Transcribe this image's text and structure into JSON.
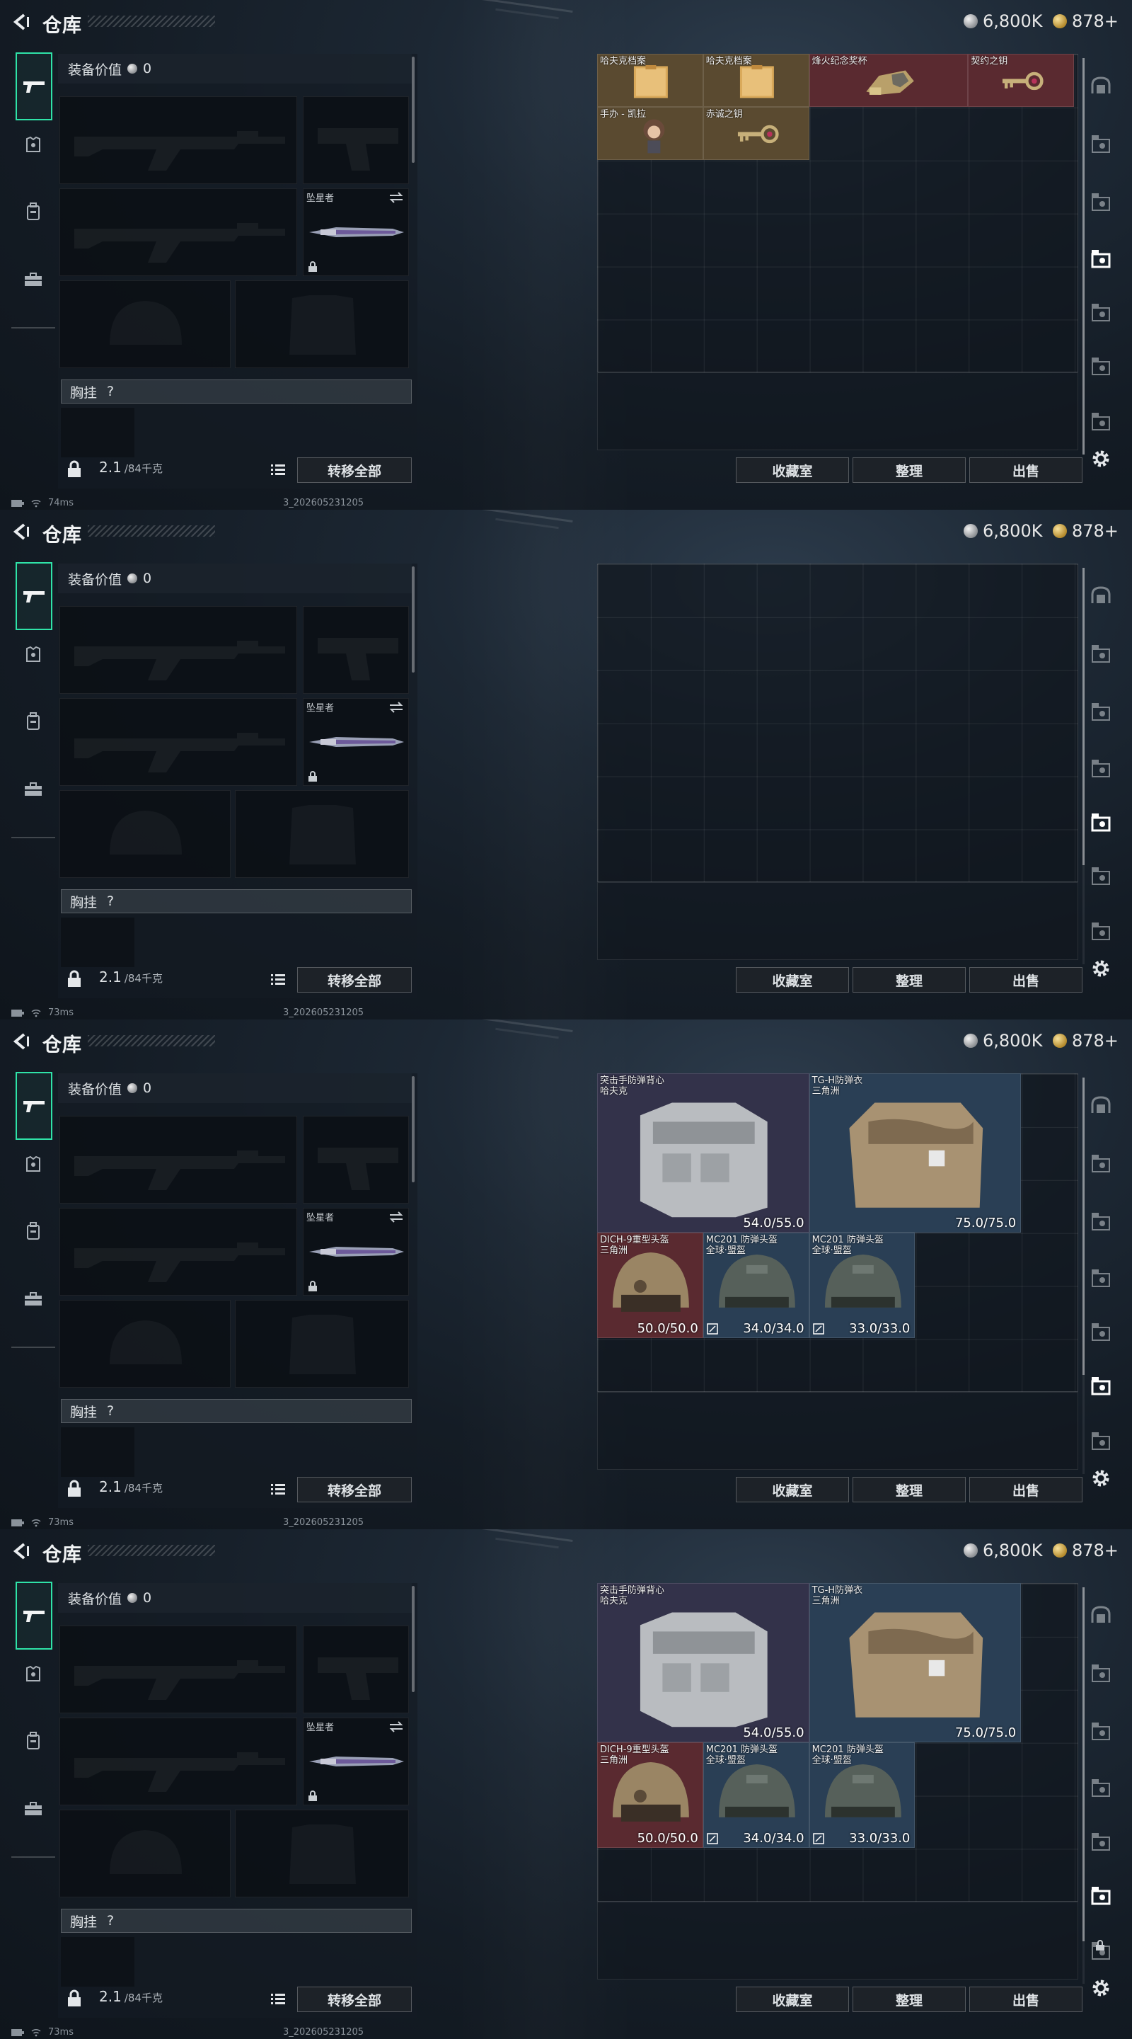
{
  "header": {
    "title": "仓库",
    "silver": "6,800K",
    "gold": "878+"
  },
  "loadout": {
    "equip_value_label": "装备价值",
    "equip_value": "0",
    "melee_name": "坠星者",
    "chest_rig_label": "胸挂",
    "chest_rig_hint": "?",
    "weight_value": "2.1",
    "weight_max": "/84千克",
    "transfer_all": "转移全部"
  },
  "stash_actions": {
    "collection": "收藏室",
    "sort": "整理",
    "sell": "出售"
  },
  "frames": [
    {
      "ping": "74ms",
      "build": "3_202605231205",
      "active_rail": 3,
      "items": [
        {
          "name": "哈夫克档案",
          "rarity": "gold",
          "col": 0,
          "row": 0,
          "w": 2,
          "h": 1,
          "art": "folder"
        },
        {
          "name": "哈夫克档案",
          "rarity": "gold",
          "col": 2,
          "row": 0,
          "w": 2,
          "h": 1,
          "art": "folder"
        },
        {
          "name": "烽火纪念奖杯",
          "rarity": "red",
          "col": 4,
          "row": 0,
          "w": 3,
          "h": 1,
          "art": "trophy"
        },
        {
          "name": "契约之钥",
          "rarity": "red",
          "col": 7,
          "row": 0,
          "w": 2,
          "h": 1,
          "art": "key"
        },
        {
          "name": "手办 - 凯拉",
          "rarity": "gold",
          "col": 0,
          "row": 1,
          "w": 2,
          "h": 1,
          "art": "figure"
        },
        {
          "name": "赤诚之钥",
          "rarity": "gold",
          "col": 2,
          "row": 1,
          "w": 2,
          "h": 1,
          "art": "key"
        }
      ]
    },
    {
      "ping": "73ms",
      "build": "3_202605231205",
      "active_rail": 4,
      "items": []
    },
    {
      "ping": "73ms",
      "build": "3_202605231205",
      "active_rail": 5,
      "items": [
        {
          "name": "突击手防弹背心",
          "sub": "哈夫克",
          "rarity": "purple",
          "col": 0,
          "row": 0,
          "w": 4,
          "h": 3,
          "art": "vest_white",
          "dura": "54.0/55.0"
        },
        {
          "name": "TG-H防弹衣",
          "sub": "三角洲",
          "rarity": "blue",
          "col": 4,
          "row": 0,
          "w": 4,
          "h": 3,
          "art": "vest_tan",
          "dura": "75.0/75.0"
        },
        {
          "name": "DICH-9重型头盔",
          "sub": "三角洲",
          "rarity": "red",
          "col": 0,
          "row": 3,
          "w": 2,
          "h": 2,
          "art": "helmet_tan",
          "dura": "50.0/50.0"
        },
        {
          "name": "MC201 防弹头盔",
          "sub": "全球·盟盔",
          "rarity": "blue",
          "col": 2,
          "row": 3,
          "w": 2,
          "h": 2,
          "art": "helmet_green",
          "dura": "34.0/34.0",
          "repair": true
        },
        {
          "name": "MC201 防弹头盔",
          "sub": "全球·盟盔",
          "rarity": "blue",
          "col": 4,
          "row": 3,
          "w": 2,
          "h": 2,
          "art": "helmet_green",
          "dura": "33.0/33.0",
          "repair": true
        }
      ]
    },
    {
      "ping": "73ms",
      "build": "3_202605231205",
      "active_rail": 5,
      "show_lock": true,
      "items": [
        {
          "name": "突击手防弹背心",
          "sub": "哈夫克",
          "rarity": "purple",
          "col": 0,
          "row": 0,
          "w": 4,
          "h": 3,
          "art": "vest_white",
          "dura": "54.0/55.0"
        },
        {
          "name": "TG-H防弹衣",
          "sub": "三角洲",
          "rarity": "blue",
          "col": 4,
          "row": 0,
          "w": 4,
          "h": 3,
          "art": "vest_tan",
          "dura": "75.0/75.0"
        },
        {
          "name": "DICH-9重型头盔",
          "sub": "三角洲",
          "rarity": "red",
          "col": 0,
          "row": 3,
          "w": 2,
          "h": 2,
          "art": "helmet_tan",
          "dura": "50.0/50.0"
        },
        {
          "name": "MC201 防弹头盔",
          "sub": "全球·盟盔",
          "rarity": "blue",
          "col": 2,
          "row": 3,
          "w": 2,
          "h": 2,
          "art": "helmet_green",
          "dura": "34.0/34.0",
          "repair": true
        },
        {
          "name": "MC201 防弹头盔",
          "sub": "全球·盟盔",
          "rarity": "blue",
          "col": 4,
          "row": 3,
          "w": 2,
          "h": 2,
          "art": "helmet_green",
          "dura": "33.0/33.0",
          "repair": true
        }
      ]
    }
  ],
  "icons": {
    "back": "back-arrow-icon",
    "left_rail": [
      "rifle-icon",
      "armor-icon",
      "backpack-icon",
      "briefcase-icon"
    ],
    "right_rail": [
      "vault-icon",
      "case-iv-icon",
      "case-iii-icon",
      "case-iv-icon",
      "case-iv-icon",
      "case-iv-icon",
      "case-iv-icon"
    ],
    "settings": "gear-icon"
  },
  "colors": {
    "accent": "#2fe3a8",
    "gold_item": "#5a4a30",
    "red_item": "#5a2a30",
    "purple_item": "#33324a",
    "blue_item": "#2a3f55"
  }
}
